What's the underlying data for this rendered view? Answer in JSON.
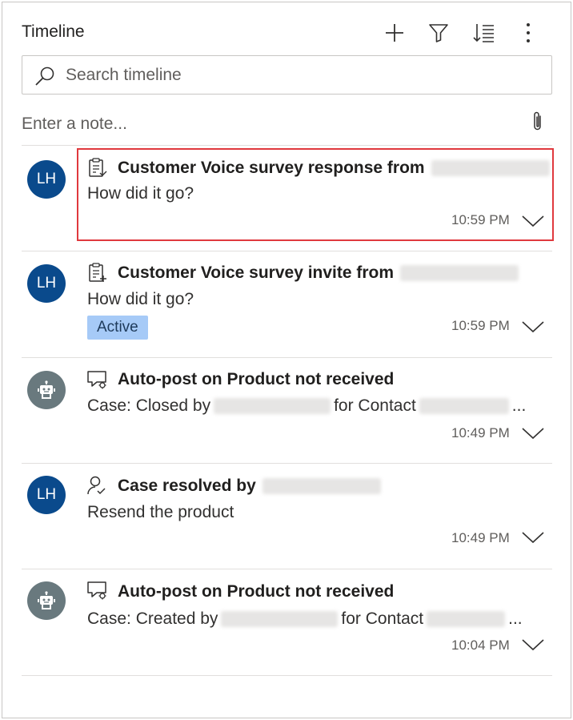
{
  "header": {
    "title": "Timeline"
  },
  "search": {
    "placeholder": "Search timeline"
  },
  "note": {
    "placeholder": "Enter a note..."
  },
  "items": [
    {
      "avatar": "LH",
      "icon": "survey-response-icon",
      "title": "Customer Voice survey response from",
      "desc": "How did it go?",
      "time": "10:59 PM"
    },
    {
      "avatar": "LH",
      "icon": "survey-invite-icon",
      "title": "Customer Voice survey invite from",
      "desc": "How did it go?",
      "badge": "Active",
      "time": "10:59 PM"
    },
    {
      "avatar": "bot",
      "icon": "auto-post-icon",
      "title": "Auto-post on Product not received",
      "desc_prefix": "Case: Closed by",
      "desc_mid": "for Contact",
      "desc_suffix": "...",
      "time": "10:49 PM"
    },
    {
      "avatar": "LH",
      "icon": "case-resolved-icon",
      "title": "Case resolved by",
      "desc": "Resend the product",
      "time": "10:49 PM"
    },
    {
      "avatar": "bot",
      "icon": "auto-post-icon",
      "title": "Auto-post on Product not received",
      "desc_prefix": "Case: Created by",
      "desc_mid": "for Contact",
      "desc_suffix": "...",
      "time": "10:04 PM"
    }
  ],
  "colors": {
    "avatar_user": "#0a4a8c",
    "avatar_bot": "#69797e",
    "badge_bg": "#a6caf7",
    "highlight": "#e0393e"
  }
}
